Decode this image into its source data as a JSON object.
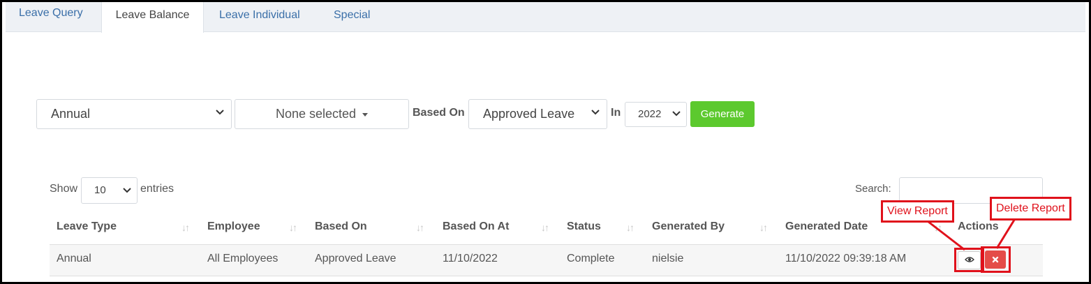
{
  "tabs": [
    {
      "label": "Leave Query"
    },
    {
      "label": "Leave Balance"
    },
    {
      "label": "Leave Individual"
    },
    {
      "label": "Special"
    }
  ],
  "filters": {
    "leave_type_value": "Annual",
    "employee_value": "None selected",
    "based_on_label": "Based On",
    "based_on_value": "Approved Leave",
    "in_label": "In",
    "year_value": "2022",
    "generate_label": "Generate"
  },
  "table_controls": {
    "show_label": "Show",
    "entries_value": "10",
    "entries_label": "entries",
    "search_label": "Search:",
    "search_value": ""
  },
  "table": {
    "columns": [
      "Leave Type",
      "Employee",
      "Based On",
      "Based On At",
      "Status",
      "Generated By",
      "Generated Date",
      "Actions"
    ],
    "rows": [
      {
        "leave_type": "Annual",
        "employee": "All Employees",
        "based_on": "Approved Leave",
        "based_on_at": "11/10/2022",
        "status": "Complete",
        "generated_by": "nielsie",
        "generated_date": "11/10/2022 09:39:18 AM"
      }
    ]
  },
  "annotations": {
    "view_report": "View Report",
    "delete_report": "Delete Report",
    "color": "#e0111b"
  },
  "colors": {
    "generate_button": "#5cc92e",
    "delete_button": "#e44c48",
    "tab_link": "#3a6fa8"
  }
}
